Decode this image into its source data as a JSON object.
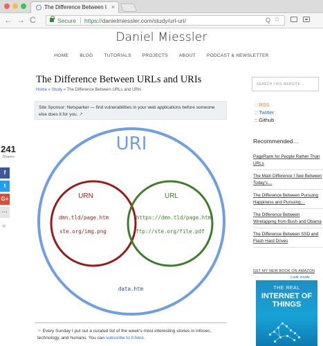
{
  "browser": {
    "tab_title": "The Difference Between URLs",
    "tab_close": "×",
    "secure_label": "Secure",
    "url_scheme": "https://",
    "url_rest": "danielmiessler.com/study/url-uri/",
    "back_icon": "←",
    "forward_icon": "→",
    "reload_icon": "C",
    "zoom_icon": "Q",
    "star_icon": "☆"
  },
  "site": {
    "title": "Daniel Miessler",
    "nav": [
      "HOME",
      "BLOG",
      "TUTORIALS",
      "PROJECTS",
      "ABOUT",
      "PODCAST & NEWSLETTER"
    ]
  },
  "article": {
    "title": "The Difference Between URLs and URIs",
    "breadcrumb": {
      "home": "Home",
      "sep1": " » ",
      "study": "Study",
      "sep2": " » ",
      "current": "The Difference Between URLs and URIs"
    },
    "sponsor_text": "Site Sponsor: Netsparker — find vulnerabilities in your web applications before someone else does it for you.",
    "sponsor_icon": "↗",
    "footer_text": "☞ Every Sunday I put out a curated list of the week's most interesting stories in infosec, technology, and humans. You can ",
    "footer_link": "subscribe to it here.",
    "colors": {
      "uri": "#6f9ee6",
      "urn": "#9a1a1a",
      "url": "#3f7d2a",
      "mono_text": "#2c4f86"
    }
  },
  "diagram": {
    "uri_label": "URI",
    "urn_label": "URN",
    "url_label": "URL",
    "urn_items": [
      "dmn.tld/page.htm",
      "ste.org/img.png"
    ],
    "url_items": [
      "https://dmn.tld/page.htm",
      "ftp://ste.org/file.pdf"
    ],
    "uri_only_item": "data.htm"
  },
  "share": {
    "count": "241",
    "label": "Shares",
    "facebook": "f",
    "twitter": "t",
    "google": "G+",
    "more": "···",
    "collapse": "«"
  },
  "sidebar": {
    "search_placeholder": "SEARCH THIS WEBSITE ...",
    "social": {
      "rss": ":: RSS",
      "twitter": ":: Twitter",
      "github": ":: Github"
    },
    "recommended_title": "Recommended…",
    "recommended": [
      "PageRank for People Rather Than URLs",
      "The Main Difference I See Between Today's…",
      "The Difference Between Pursuing Happiness and Pursuing…",
      "The Difference Between Wiretapping from Bush and Obama",
      "The Difference Between SSD and Flash Hard Drives"
    ],
    "book_heading": "GET MY NEW BOOK ON AMAZON",
    "look_inside": "Look inside",
    "book": {
      "the": "THE REAL",
      "main": "INTERNET OF THINGS",
      "sub": ""
    }
  }
}
